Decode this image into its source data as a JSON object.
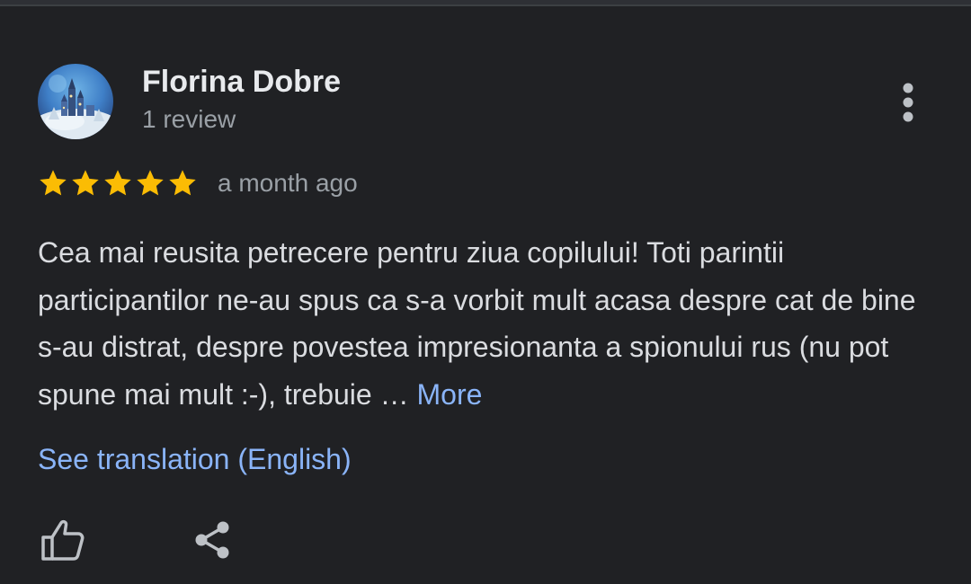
{
  "review": {
    "author": {
      "name": "Florina Dobre",
      "review_count": "1 review",
      "avatar": "winter-castle-photo"
    },
    "rating": {
      "stars": 5,
      "max_stars": 5,
      "star_color": "#fbbc04"
    },
    "timestamp": "a month ago",
    "text": "Cea mai reusita petrecere pentru ziua copilului! Toti parintii participantilor ne-au spus ca s-a vorbit mult acasa despre cat de bine s-au distrat, despre povestea impresionanta a spionului rus (nu pot spune mai mult :-), trebuie …",
    "more_label": "More",
    "translate_label": "See translation (English)"
  },
  "actions": {
    "menu_icon": "more-vert-icon",
    "like_icon": "thumb-up-icon",
    "share_icon": "share-icon"
  },
  "colors": {
    "background": "#202124",
    "primary_text": "#e8eaed",
    "secondary_text": "#9aa0a6",
    "link": "#8ab4f8",
    "icon": "#bdc1c6"
  }
}
